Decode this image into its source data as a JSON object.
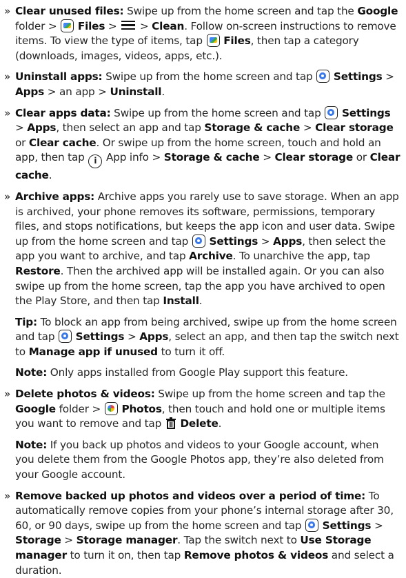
{
  "bullet": "»",
  "icons": {
    "files": "google-files-icon",
    "menu": "menu-icon",
    "settings": "settings-icon",
    "info": "info-icon",
    "photos": "google-photos-icon",
    "trash": "trash-icon"
  },
  "clear_unused": {
    "label": "Clear unused files:",
    "t1": " Swipe up from the home screen and tap the ",
    "google": "Google",
    "t2": " folder > ",
    "files": "Files",
    "t3": " > ",
    "t4": " > ",
    "clean": "Clean",
    "t5": ". Follow on-screen instructions to remove items. To view the type of items, tap ",
    "files2": "Files",
    "t6": ", then tap a category (downloads, images, videos, apps, etc.)."
  },
  "uninstall": {
    "label": "Uninstall apps:",
    "t1": " Swipe up from the home screen and tap ",
    "settings": "Settings",
    "t2": " > ",
    "apps": "Apps",
    "t3": " > an app > ",
    "uninstall": "Uninstall",
    "t4": "."
  },
  "clear_data": {
    "label": "Clear apps data:",
    "t1": " Swipe up from the home screen and tap ",
    "settings": "Settings",
    "t2": " > ",
    "apps": "Apps",
    "t3": ", then select an app and tap ",
    "storage_cache": "Storage & cache",
    "t4": " > ",
    "clear_storage": "Clear storage",
    "t5": " or ",
    "clear_cache": "Clear cache",
    "t6": ". Or swipe up from the home screen, touch and hold an app, then tap ",
    "t7": " App info > ",
    "storage_cache2": "Storage & cache",
    "t8": " > ",
    "clear_storage2": "Clear storage",
    "t9": " or ",
    "clear_cache2": "Clear cache",
    "t10": "."
  },
  "archive": {
    "label": "Archive apps:",
    "t1": " Archive apps you rarely use to save storage. When an app is archived, your phone removes its software, permissions, temporary files, and stops notifications, but keeps the app icon and user data. Swipe up from the home screen and tap ",
    "settings": "Settings",
    "t2": " > ",
    "apps": "Apps",
    "t3": ", then select the app you want to archive, and tap ",
    "archive": "Archive",
    "t4": ". To unarchive the app, tap ",
    "restore": "Restore",
    "t5": ". Then the archived app will be installed again. Or you can also swipe up from the home screen, tap the app you have archived to open the Play Store, and then tap ",
    "install": "Install",
    "t6": "."
  },
  "tip": {
    "label": "Tip:",
    "t1": " To block an app from being archived, swipe up from the home screen and tap ",
    "settings": "Settings",
    "t2": " > ",
    "apps": "Apps",
    "t3": ", select an app, and then tap the switch next to ",
    "manage": "Manage app if unused",
    "t4": " to turn it off."
  },
  "note1": {
    "label": "Note:",
    "t1": " Only apps installed from Google Play support this feature."
  },
  "delete_photos": {
    "label": "Delete photos & videos:",
    "t1": " Swipe up from the home screen and tap the ",
    "google": "Google",
    "t2": " folder > ",
    "photos": "Photos",
    "t3": ", then touch and hold one or multiple items you want to remove and tap ",
    "delete": "Delete",
    "t4": "."
  },
  "note2": {
    "label": "Note:",
    "t1": " If you back up photos and videos to your Google account, when you delete them from the Google Photos app, they’re also deleted from your Google account."
  },
  "remove_backed": {
    "label": "Remove backed up photos and videos over a period of time:",
    "t1": " To automatically remove copies from your phone’s internal storage after 30, 60, or 90 days, swipe up from the home screen and tap ",
    "settings": "Settings",
    "t2": " > ",
    "storage": "Storage",
    "t3": " > ",
    "storage_manager": "Storage manager",
    "t4": ". Tap the switch next to ",
    "use_storage_manager": "Use Storage manager",
    "t5": " to turn it on, then tap ",
    "remove_pv": "Remove photos & videos",
    "t6": " and select a duration."
  }
}
